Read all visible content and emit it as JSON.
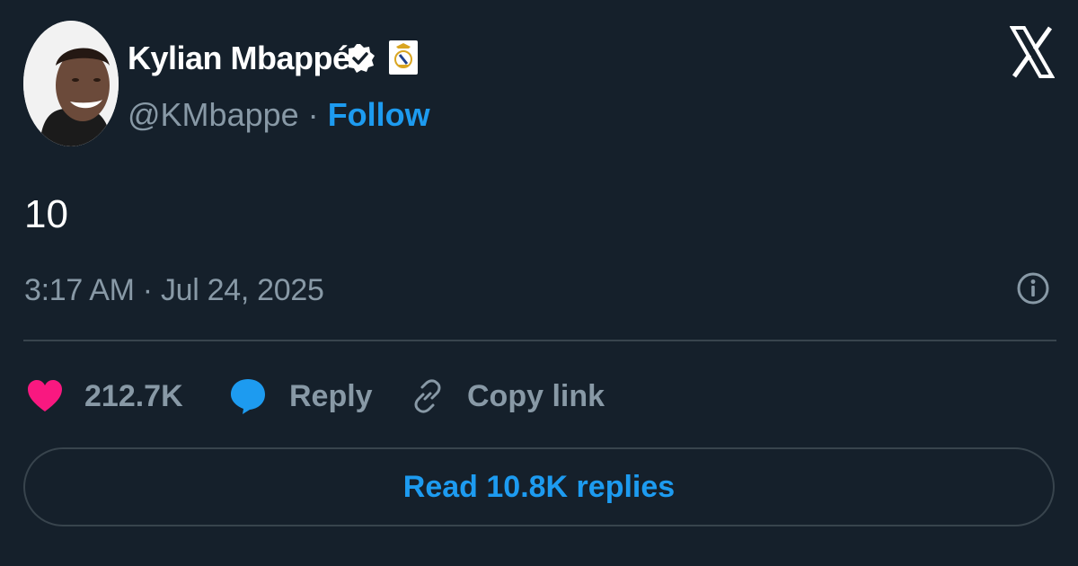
{
  "author": {
    "display_name": "Kylian Mbappé",
    "handle": "@KMbappe",
    "separator": "·",
    "follow_label": "Follow",
    "verified_icon": "verified-badge-icon",
    "club_icon": "real-madrid-crest-icon"
  },
  "tweet": {
    "text": "10",
    "timestamp": "3:17 AM · Jul 24, 2025"
  },
  "actions": {
    "likes_count": "212.7K",
    "reply_label": "Reply",
    "copy_link_label": "Copy link",
    "read_replies_label": "Read 10.8K replies"
  },
  "colors": {
    "background": "#15202b",
    "accent": "#1d9bf0",
    "like": "#f91880",
    "muted": "#8899a6",
    "divider": "#38444d"
  }
}
